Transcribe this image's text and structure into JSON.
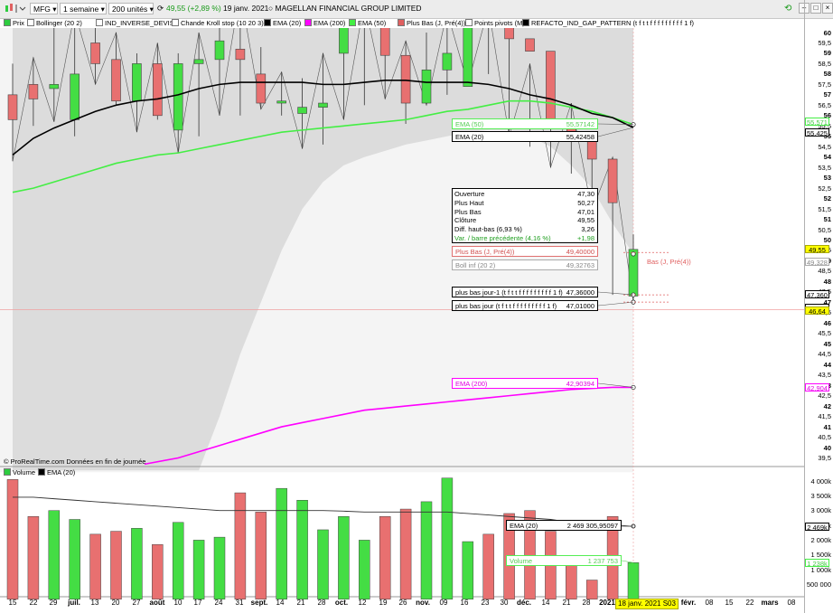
{
  "toolbar": {
    "ticker": "MFG",
    "period": "1 semaine",
    "units": "200 unités",
    "quote": "49,55 (+2,89 %)",
    "date": "19 janv. 2021",
    "company": "MAGELLAN FINANCIAL GROUP LIMITED"
  },
  "legend": [
    {
      "label": "Prix",
      "color": "#2ecc40"
    },
    {
      "label": "Bollinger (20 2)",
      "color": "#ffffff"
    },
    {
      "label": "IND_INVERSE_DEVISE",
      "color": "#ffffff"
    },
    {
      "label": "Chande Kroll stop (10 20 3)",
      "color": "#ffffff"
    },
    {
      "label": "EMA (20)",
      "color": "#000000"
    },
    {
      "label": "EMA (200)",
      "color": "#ff00ff"
    },
    {
      "label": "EMA (50)",
      "color": "#44ee44"
    },
    {
      "label": "Plus Bas (J, Pré(4))",
      "color": "#e06060"
    },
    {
      "label": "Points pivots (M)",
      "color": "#ffffff"
    },
    {
      "label": "REFACTO_IND_GAP_PATTERN (t f t t f f f f f f f f f 1 f)",
      "color": "#000000"
    }
  ],
  "volume_legend": [
    {
      "label": "Volume",
      "color": "#2ecc40"
    },
    {
      "label": "EMA (20)",
      "color": "#000000"
    }
  ],
  "price_axis": [
    "60",
    "59,5",
    "59",
    "58,5",
    "58",
    "57,5",
    "57",
    "56,5",
    "56",
    "55,5",
    "55",
    "54,5",
    "54",
    "53,5",
    "53",
    "52,5",
    "52",
    "51,5",
    "51",
    "50,5",
    "50",
    "49,5",
    "49",
    "48,5",
    "48",
    "47,5",
    "47",
    "46,5",
    "46",
    "45,5",
    "45",
    "44,5",
    "44",
    "43,5",
    "43",
    "42,5",
    "42",
    "41,5",
    "41",
    "40,5",
    "40",
    "39,5"
  ],
  "price_badges": {
    "ema50": "55,571",
    "ema20": "55,425",
    "last": "49,55",
    "bollinf": "49,328",
    "low1": "47,360",
    "low0": "47,010",
    "cursor": "46,64",
    "ema200": "42,904"
  },
  "volume_axis": [
    "4 000k",
    "3 500k",
    "3 000k",
    "2 500k",
    "2 000k",
    "1 500k",
    "1 000k",
    "500 000"
  ],
  "volume_badges": {
    "ema20": "2 469k",
    "volume": "1 238k"
  },
  "x_axis": [
    "15",
    "22",
    "29",
    "juil.",
    "13",
    "20",
    "27",
    "août",
    "10",
    "17",
    "24",
    "31",
    "sept.",
    "14",
    "21",
    "28",
    "oct.",
    "12",
    "19",
    "26",
    "nov.",
    "09",
    "16",
    "23",
    "30",
    "déc.",
    "14",
    "21",
    "28",
    "2021",
    "18 janv. 2021 S03",
    "févr.",
    "08",
    "15",
    "22",
    "mars",
    "08"
  ],
  "ohlc": [
    {
      "label": "Ouverture",
      "value": "47,30",
      "color": "#000000"
    },
    {
      "label": "Plus Haut",
      "value": "50,27",
      "color": "#000000"
    },
    {
      "label": "Plus Bas",
      "value": "47,01",
      "color": "#000000"
    },
    {
      "label": "Clôture",
      "value": "49,55",
      "color": "#000000"
    },
    {
      "label": "Diff. haut-bas (6,93 %)",
      "value": "3,26",
      "color": "#000000"
    },
    {
      "label": "Var. / barre précédente (4,16 %)",
      "value": "+1,98",
      "color": "#22a022"
    }
  ],
  "labels": {
    "ema50": {
      "name": "EMA (50)",
      "value": "55,57142"
    },
    "ema20": {
      "name": "EMA (20)",
      "value": "55,42458"
    },
    "plusbas": {
      "name": "Plus Bas (J, Pré(4))",
      "value": "49,40000"
    },
    "bollinf": {
      "name": "Boll inf (20 2)",
      "value": "49,32763"
    },
    "low1": {
      "name": "plus bas jour-1 (t f t t f f f f f f f f f 1 f)",
      "value": "47,36000"
    },
    "low0": {
      "name": "plus bas jour (t f t t f f f f f f f f f 1 f)",
      "value": "47,01000"
    },
    "ema200": {
      "name": "EMA (200)",
      "value": "42,90394"
    },
    "plusbas_short": "Bas (J, Pré(4))",
    "vol_ema": {
      "name": "EMA (20)",
      "value": "2 469 305,95097"
    },
    "vol": {
      "name": "Volume",
      "value": "1 237 753"
    }
  },
  "credit": "© ProRealTime.com  Données en fin de journée",
  "chart_data": {
    "type": "candlestick",
    "x": [
      "15",
      "22",
      "29",
      "juil.",
      "13",
      "20",
      "27",
      "août",
      "10",
      "17",
      "24",
      "31",
      "sept.",
      "14",
      "21",
      "28",
      "oct.",
      "12",
      "19",
      "26",
      "nov.",
      "09",
      "16",
      "23",
      "30",
      "déc.",
      "14",
      "21",
      "28",
      "2021",
      "18 janv. 2021 S03"
    ],
    "series": [
      {
        "name": "Prix",
        "open": [
          57.0,
          57.5,
          57.3,
          55.8,
          59.5,
          58.7,
          56.7,
          58.5,
          55.3,
          58.5,
          58.7,
          59.2,
          58.0,
          56.6,
          56.1,
          56.4,
          59.0,
          60.3,
          60.3,
          58.9,
          56.6,
          58.2,
          57.4,
          60.4,
          60.3,
          59.7,
          59.1,
          55.5,
          54.8,
          53.9,
          47.3
        ],
        "high": [
          58.5,
          58.8,
          60.5,
          61.0,
          60.8,
          60.0,
          59.0,
          59.5,
          59.0,
          60.0,
          61.0,
          62.0,
          59.3,
          58.1,
          57.8,
          59.0,
          61.0,
          61.5,
          61.5,
          59.6,
          60.0,
          61.0,
          61.0,
          61.2,
          61.0,
          58.5,
          57.0,
          56.6,
          55.0,
          54.0,
          50.27
        ],
        "low": [
          53.8,
          55.5,
          55.7,
          55.0,
          57.5,
          56.5,
          55.2,
          55.8,
          54.2,
          55.0,
          56.0,
          56.0,
          56.3,
          56.0,
          54.4,
          54.6,
          55.8,
          56.5,
          56.8,
          55.6,
          56.5,
          57.0,
          57.5,
          58.0,
          55.0,
          54.5,
          53.5,
          53.2,
          51.4,
          47.36,
          47.01
        ],
        "close": [
          55.8,
          56.8,
          57.5,
          58.0,
          58.5,
          56.7,
          58.5,
          56.0,
          58.5,
          58.7,
          59.6,
          58.7,
          56.6,
          56.7,
          56.4,
          56.6,
          60.3,
          60.3,
          58.9,
          56.6,
          58.2,
          59.0,
          60.4,
          60.3,
          59.7,
          59.1,
          55.5,
          54.8,
          53.9,
          51.8,
          49.55
        ]
      },
      {
        "name": "Volume",
        "values": [
          4.05,
          2.8,
          3.0,
          2.7,
          2.2,
          2.3,
          2.4,
          1.85,
          2.6,
          2.0,
          2.1,
          3.6,
          2.95,
          3.75,
          3.35,
          2.35,
          2.8,
          2.0,
          2.8,
          3.05,
          3.3,
          4.1,
          1.95,
          2.2,
          2.9,
          3.0,
          2.3,
          1.3,
          0.65,
          2.8,
          1.238
        ]
      },
      {
        "name": "EMA (20)",
        "values": [
          54.1,
          54.9,
          55.4,
          55.8,
          56.2,
          56.5,
          56.7,
          56.8,
          57.0,
          57.3,
          57.5,
          57.6,
          57.6,
          57.6,
          57.6,
          57.5,
          57.5,
          57.6,
          57.7,
          57.7,
          57.6,
          57.6,
          57.6,
          57.5,
          57.3,
          57.0,
          56.8,
          56.5,
          56.1,
          55.9,
          55.42
        ]
      },
      {
        "name": "EMA (50)",
        "values": [
          52.3,
          52.5,
          52.8,
          53.1,
          53.4,
          53.7,
          53.9,
          54.1,
          54.2,
          54.4,
          54.6,
          54.8,
          55.0,
          55.2,
          55.3,
          55.4,
          55.5,
          55.6,
          55.7,
          55.8,
          56.0,
          56.2,
          56.3,
          56.5,
          56.7,
          56.7,
          56.6,
          56.4,
          56.2,
          55.9,
          55.57
        ]
      },
      {
        "name": "EMA (200)",
        "values": [
          null,
          null,
          null,
          null,
          null,
          null,
          null,
          null,
          39.5,
          39.8,
          40.1,
          40.4,
          40.7,
          41.0,
          41.2,
          41.4,
          41.6,
          41.8,
          41.9,
          42.0,
          42.1,
          42.2,
          42.3,
          42.4,
          42.5,
          42.6,
          42.7,
          42.8,
          42.85,
          42.9,
          42.9
        ]
      }
    ],
    "ylim": [
      39,
      60.3
    ],
    "ylabel": "",
    "xlabel": ""
  }
}
